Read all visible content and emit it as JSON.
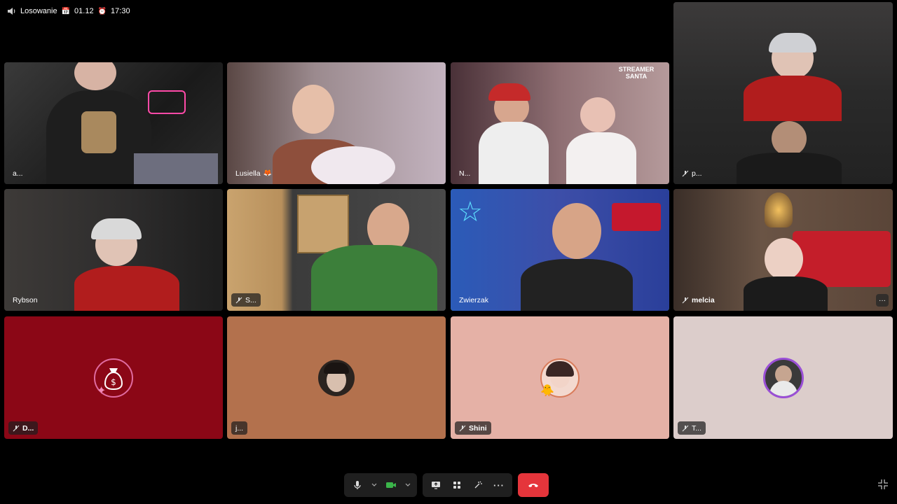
{
  "topbar": {
    "speaker_icon": "speaker-icon",
    "title": "Losowanie",
    "date_emoji": "📅",
    "date": "01.12",
    "clock_emoji": "⏰",
    "time": "17:30"
  },
  "tiles": {
    "t1": {
      "name": "a..."
    },
    "t2": {
      "name": "Lusiella",
      "emoji": "🦊"
    },
    "t3": {
      "name": "N...",
      "overlay_text": "STREAMER SANTA"
    },
    "t4": {
      "name": "p..."
    },
    "t5": {
      "name": "Rybson"
    },
    "t6": {
      "name": "S..."
    },
    "t7": {
      "name": "Zwierzak"
    },
    "t8": {
      "name": "melcia",
      "more": "···"
    },
    "t9": {
      "name": "D...",
      "color": "#8b0716"
    },
    "t10": {
      "name": "j...",
      "color": "#b3714d"
    },
    "t11": {
      "name": "Shini",
      "color": "#e5b1a6"
    },
    "t12": {
      "name": "T...",
      "color": "#dccdcb"
    }
  },
  "toolbar": {
    "mic_icon": "microphone-icon",
    "camera_icon": "camera-icon",
    "share_icon": "share-screen-icon",
    "grid_icon": "grid-icon",
    "effects_icon": "effects-icon",
    "more_label": "···",
    "end_call_icon": "phone-hangup-icon"
  },
  "colors": {
    "end_call": "#e5353b",
    "selected_border": "#3bb54a",
    "camera_active": "#3bb54a"
  }
}
